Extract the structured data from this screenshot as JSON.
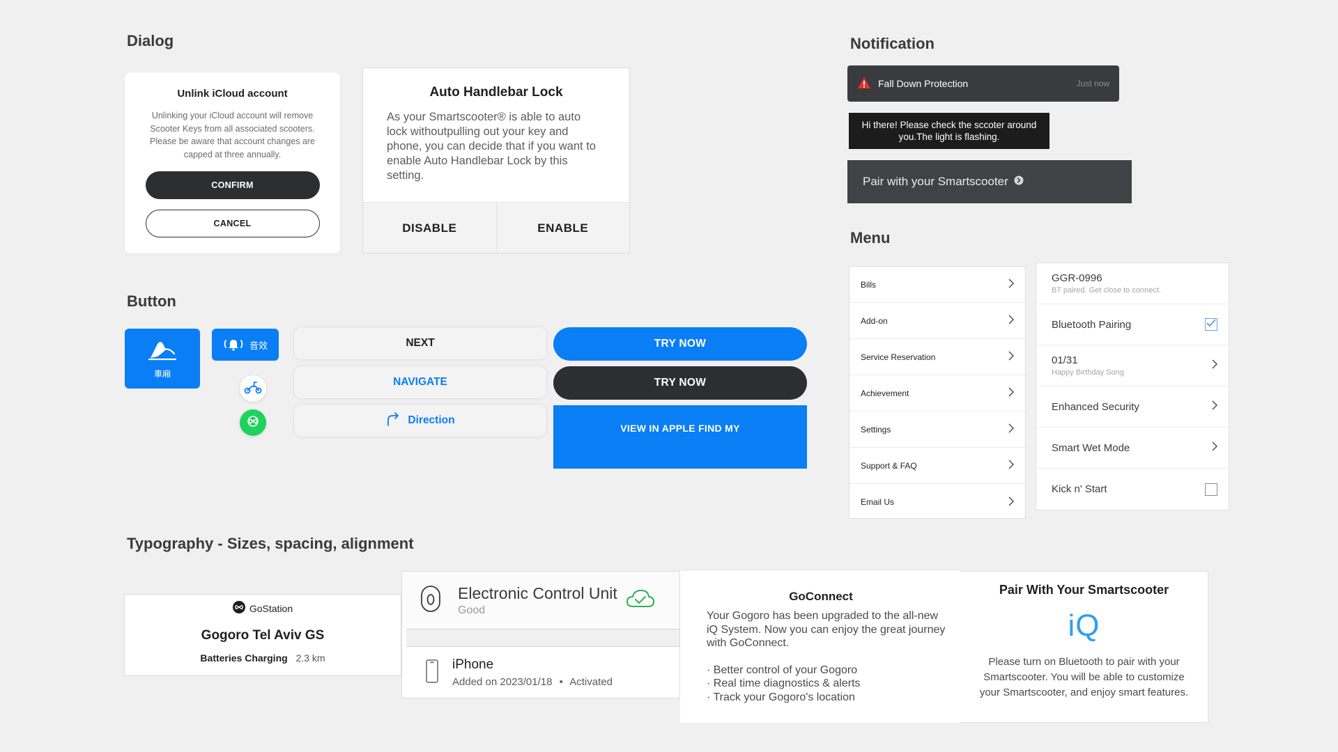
{
  "sections": {
    "dialog": "Dialog",
    "button": "Button",
    "notification": "Notification",
    "menu": "Menu",
    "typography": "Typography - Sizes, spacing, alignment"
  },
  "dialog_icloud": {
    "title": "Unlink iCloud account",
    "body": "Unlinking your iCloud account will remove Scooter Keys from all associated scooters. Please be aware that account changes are capped at three annually.",
    "confirm": "CONFIRM",
    "cancel": "CANCEL"
  },
  "dialog_handlebar": {
    "title": "Auto Handlebar Lock",
    "body": "As your Smartscooter® is able to auto lock withoutpulling out your key and phone, you can decide that if you want to enable Auto Handlebar Lock by this setting.",
    "disable": "DISABLE",
    "enable": "ENABLE"
  },
  "buttons": {
    "trunk_label": "車廂",
    "sound_label": "音效",
    "next": "NEXT",
    "navigate": "NAVIGATE",
    "direction": "Direction",
    "try_now_blue": "TRY NOW",
    "try_now_dark": "TRY NOW",
    "apple_find_my": "VIEW IN APPLE FIND MY",
    "colors": {
      "blue": "#0a7ef5",
      "dark": "#2d2e32",
      "green": "#1fd25d"
    }
  },
  "notifications": {
    "fall_down": {
      "title": "Fall Down Protection",
      "time": "Just now",
      "icon": "warning-icon",
      "icon_color": "#e8322a"
    },
    "check_scooter": "Hi there! Please check the sccoter around you.The light is flashing.",
    "pair": "Pair with your Smartscooter"
  },
  "menu_main": {
    "items": [
      {
        "label": "Bills"
      },
      {
        "label": "Add-on"
      },
      {
        "label": "Service Reservation"
      },
      {
        "label": "Achievement"
      },
      {
        "label": "Settings"
      },
      {
        "label": "Support & FAQ"
      },
      {
        "label": "Email Us"
      }
    ]
  },
  "menu_settings": {
    "device": {
      "name": "GGR-0996",
      "status": "BT paired. Get close to connect."
    },
    "bluetooth": {
      "label": "Bluetooth Pairing",
      "checked": true
    },
    "birthday": {
      "date": "01/31",
      "song": "Happy Birthday Song"
    },
    "security": "Enhanced Security",
    "wet_mode": "Smart Wet Mode",
    "kick_start": {
      "label": "Kick n' Start",
      "checked": false
    }
  },
  "gostation": {
    "brand": "GoStation",
    "name": "Gogoro Tel Aviv GS",
    "status": "Batteries Charging",
    "distance": "2.3 km"
  },
  "ecu": {
    "title": "Electronic Control Unit",
    "status": "Good",
    "phone": "iPhone",
    "added": "Added on 2023/01/18",
    "separator": "•",
    "activated": "Activated",
    "ok_color": "#2bb24c"
  },
  "goconnect": {
    "title": "GoConnect",
    "body": "Your Gogoro has been upgraded to the all-new iQ System. Now you can enjoy the great journey with GoConnect.",
    "bullets": [
      "· Better control of your Gogoro",
      "· Real time diagnostics & alerts",
      "· Track your Gogoro's location"
    ]
  },
  "pair_card": {
    "title": "Pair With Your Smartscooter",
    "logo": "iQ",
    "body": "Please turn on Bluetooth to pair with your Smartscooter. You will be able to customize your Smartscooter, and enjoy smart features."
  }
}
